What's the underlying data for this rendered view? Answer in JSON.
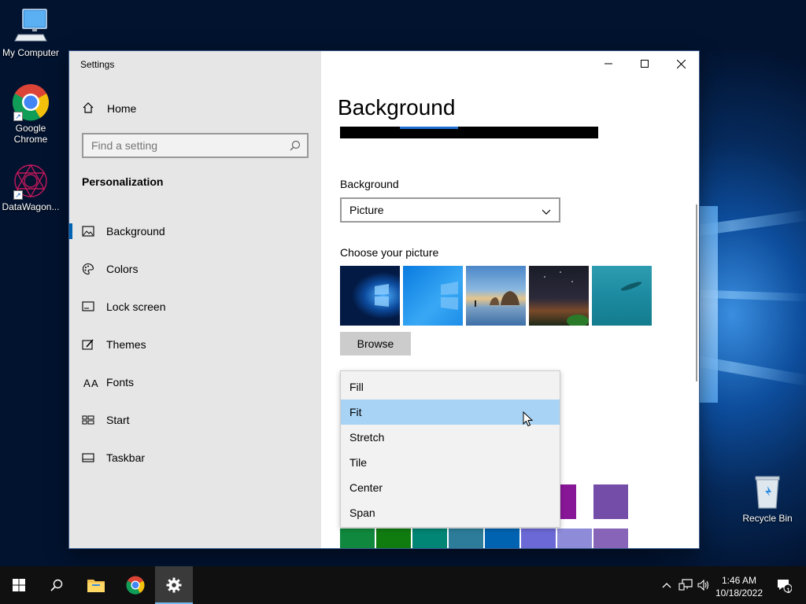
{
  "desktop": {
    "icons": [
      {
        "label": "My Computer"
      },
      {
        "label": "Google Chrome"
      },
      {
        "label": "DataWagon..."
      },
      {
        "label": "Recycle Bin"
      }
    ]
  },
  "window": {
    "title": "Settings",
    "controls": {
      "minimize": "minimize-icon",
      "maximize": "maximize-icon",
      "close": "close-icon"
    }
  },
  "sidebar": {
    "home_label": "Home",
    "search_placeholder": "Find a setting",
    "section": "Personalization",
    "items": [
      {
        "label": "Background",
        "icon": "picture-icon",
        "active": true
      },
      {
        "label": "Colors",
        "icon": "palette-icon"
      },
      {
        "label": "Lock screen",
        "icon": "lock-screen-icon"
      },
      {
        "label": "Themes",
        "icon": "themes-icon"
      },
      {
        "label": "Fonts",
        "icon": "fonts-icon"
      },
      {
        "label": "Start",
        "icon": "start-icon"
      },
      {
        "label": "Taskbar",
        "icon": "taskbar-icon"
      }
    ]
  },
  "main": {
    "title": "Background",
    "background_label": "Background",
    "background_value": "Picture",
    "choose_label": "Choose your picture",
    "browse_label": "Browse",
    "fit_options": [
      "Fill",
      "Fit",
      "Stretch",
      "Tile",
      "Center",
      "Span"
    ],
    "fit_highlighted": "Fit"
  },
  "taskbar": {
    "time": "1:46 AM",
    "date": "10/18/2022",
    "notification_count": "1"
  },
  "colors": {
    "accent": "#0063b1",
    "dropdown_highlight": "#a8d3f5",
    "sidebar_bg": "#e6e6e6",
    "taskbar_bg": "#101010"
  }
}
